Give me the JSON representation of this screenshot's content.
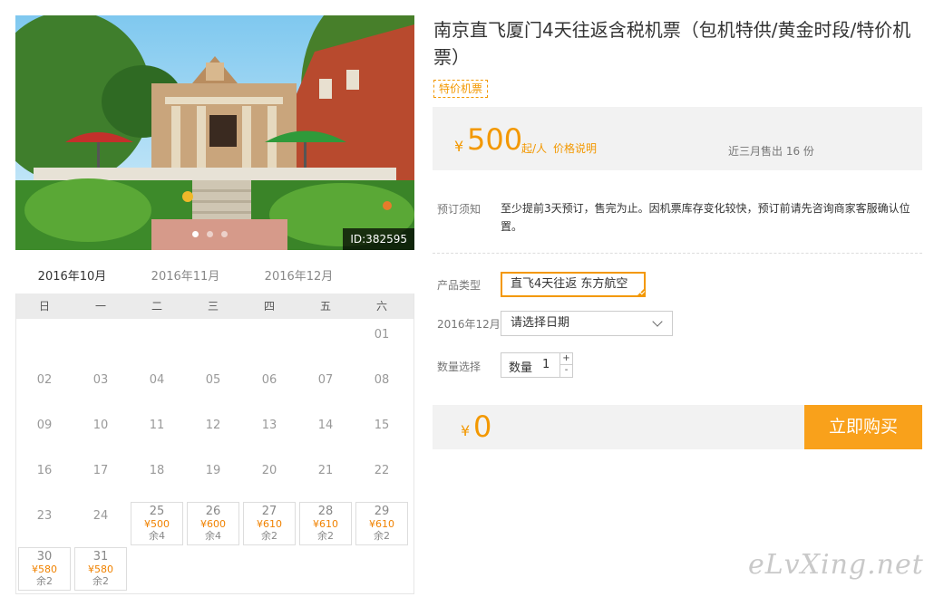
{
  "product": {
    "title": "南京直飞厦门4天往返含税机票（包机特供/黄金时段/特价机票）",
    "tag": "特价机票",
    "photo_id": "ID:382595",
    "photo_subject": "colonial villa with garden and red/green umbrellas",
    "photo_dots": 3,
    "photo_active_dot": 0
  },
  "price": {
    "currency": "¥",
    "amount": "500",
    "unit": "起/人",
    "note_link": "价格说明",
    "sold": "近三月售出 16 份"
  },
  "notice": {
    "label": "预订须知",
    "text": "至少提前3天预订，售完为止。因机票库存变化较快，预订前请先咨询商家客服确认位置。"
  },
  "options": {
    "type_label": "产品类型",
    "type_value": "直飞4天往返 东方航空",
    "date_label": "2016年12月",
    "date_placeholder": "请选择日期",
    "qty_label": "数量选择",
    "qty_inner_label": "数量",
    "qty_value": "1",
    "plus": "+",
    "minus": "-"
  },
  "total": {
    "currency": "¥",
    "amount": "0",
    "buy_label": "立即购买"
  },
  "calendar": {
    "months": [
      "2016年10月",
      "2016年11月",
      "2016年12月"
    ],
    "active_month": 0,
    "weekdays": [
      "日",
      "一",
      "二",
      "三",
      "四",
      "五",
      "六"
    ],
    "first_weekday": 6,
    "days": [
      {
        "d": "01"
      },
      {
        "d": "02"
      },
      {
        "d": "03"
      },
      {
        "d": "04"
      },
      {
        "d": "05"
      },
      {
        "d": "06"
      },
      {
        "d": "07"
      },
      {
        "d": "08"
      },
      {
        "d": "09"
      },
      {
        "d": "10"
      },
      {
        "d": "11"
      },
      {
        "d": "12"
      },
      {
        "d": "13"
      },
      {
        "d": "14"
      },
      {
        "d": "15"
      },
      {
        "d": "16"
      },
      {
        "d": "17"
      },
      {
        "d": "18"
      },
      {
        "d": "19"
      },
      {
        "d": "20"
      },
      {
        "d": "21"
      },
      {
        "d": "22"
      },
      {
        "d": "23"
      },
      {
        "d": "24"
      },
      {
        "d": "25",
        "price": "¥500",
        "left": "余4"
      },
      {
        "d": "26",
        "price": "¥600",
        "left": "余4"
      },
      {
        "d": "27",
        "price": "¥610",
        "left": "余2"
      },
      {
        "d": "28",
        "price": "¥610",
        "left": "余2"
      },
      {
        "d": "29",
        "price": "¥610",
        "left": "余2"
      },
      {
        "d": "30",
        "price": "¥580",
        "left": "余2"
      },
      {
        "d": "31",
        "price": "¥580",
        "left": "余2"
      }
    ]
  },
  "watermark": "eLvXing.net",
  "colors": {
    "accent": "#f39800",
    "buy_button": "#f9a11b",
    "panel_bg": "#f2f2f2"
  }
}
